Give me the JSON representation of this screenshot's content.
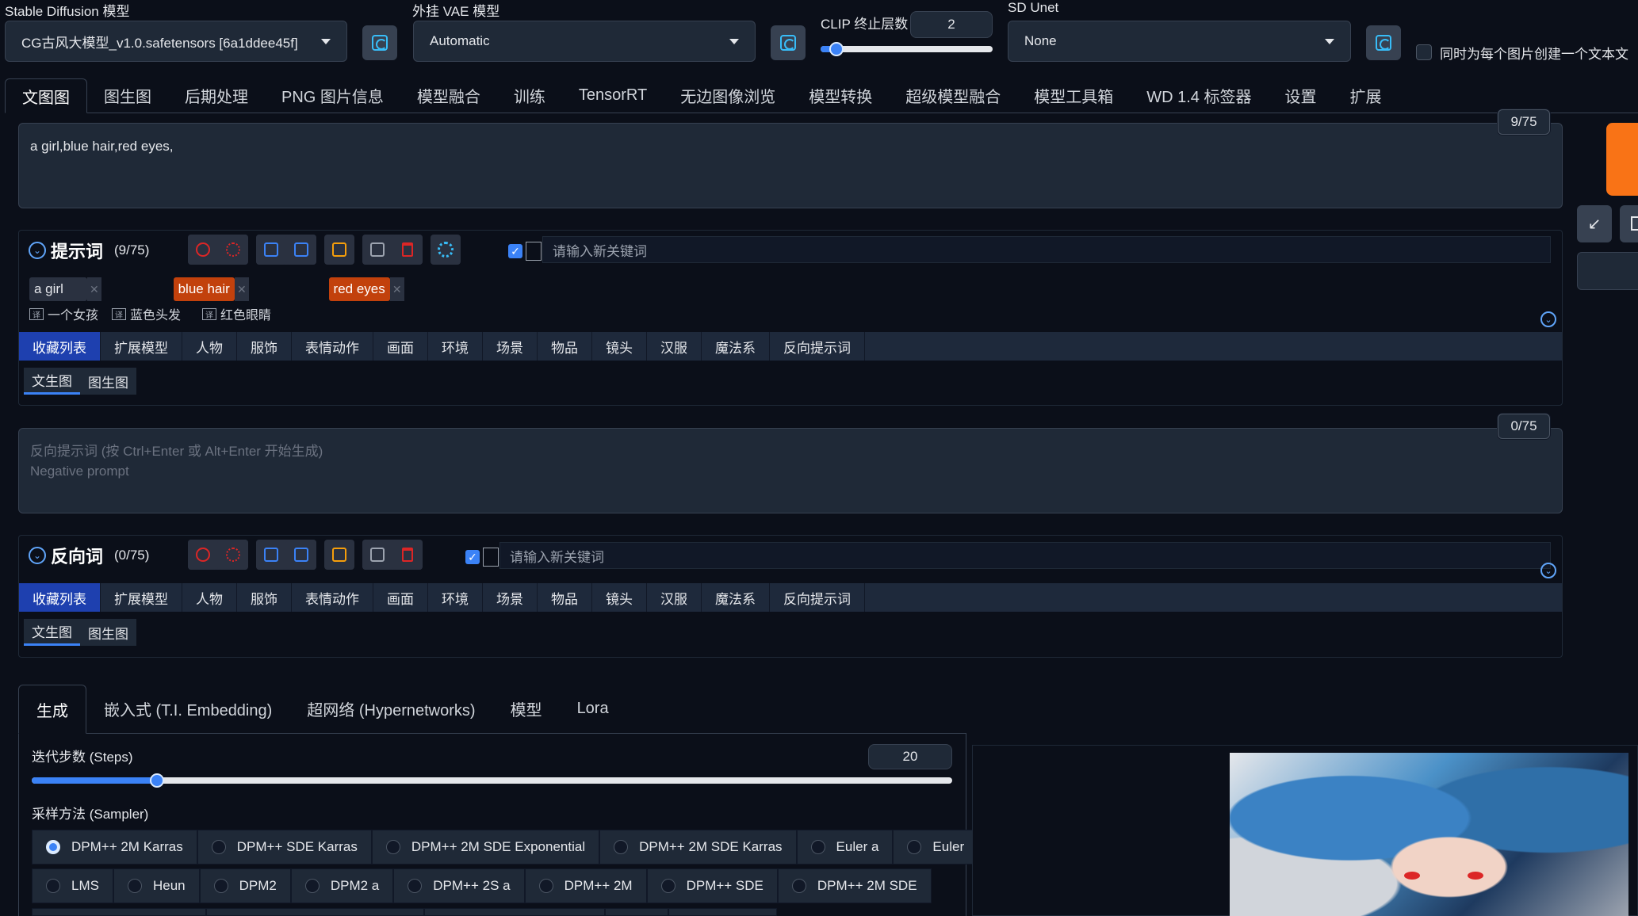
{
  "top": {
    "sd_model_label": "Stable Diffusion 模型",
    "sd_model_value": "CG古风大模型_v1.0.safetensors [6a1ddee45f]",
    "vae_label": "外挂 VAE 模型",
    "vae_value": "Automatic",
    "clip_label": "CLIP 终止层数",
    "clip_value": "2",
    "unet_label": "SD Unet",
    "unet_value": "None",
    "caption_checkbox_label": "同时为每个图片创建一个文本文"
  },
  "main_tabs": [
    "文图图",
    "图生图",
    "后期处理",
    "PNG 图片信息",
    "模型融合",
    "训练",
    "TensorRT",
    "无边图像浏览",
    "模型转换",
    "超级模型融合",
    "模型工具箱",
    "WD 1.4 标签器",
    "设置",
    "扩展"
  ],
  "prompt": {
    "text": "a girl,blue hair,red eyes,",
    "counter": "9/75"
  },
  "prompt_helper": {
    "title": "提示词",
    "count": "(9/75)",
    "keyword_placeholder": "请输入新关键词",
    "tags": [
      {
        "en": "a girl",
        "zh": "一个女孩"
      },
      {
        "en": "blue hair",
        "zh": "蓝色头发"
      },
      {
        "en": "red eyes",
        "zh": "红色眼睛"
      }
    ],
    "categories": [
      "收藏列表",
      "扩展模型",
      "人物",
      "服饰",
      "表情动作",
      "画面",
      "环境",
      "场景",
      "物品",
      "镜头",
      "汉服",
      "魔法系",
      "反向提示词"
    ],
    "subtabs": [
      "文生图",
      "图生图"
    ]
  },
  "negative": {
    "placeholder_line1": "反向提示词 (按 Ctrl+Enter 或 Alt+Enter 开始生成)",
    "placeholder_line2": "Negative prompt",
    "counter": "0/75"
  },
  "negative_helper": {
    "title": "反向词",
    "count": "(0/75)",
    "keyword_placeholder": "请输入新关键词",
    "categories": [
      "收藏列表",
      "扩展模型",
      "人物",
      "服饰",
      "表情动作",
      "画面",
      "环境",
      "场景",
      "物品",
      "镜头",
      "汉服",
      "魔法系",
      "反向提示词"
    ],
    "subtabs": [
      "文生图",
      "图生图"
    ]
  },
  "gen_tabs": [
    "生成",
    "嵌入式 (T.I. Embedding)",
    "超网络 (Hypernetworks)",
    "模型",
    "Lora"
  ],
  "steps": {
    "label": "迭代步数 (Steps)",
    "value": "20",
    "fraction": 0.136
  },
  "clip_slider_fraction": 0.09,
  "sampler": {
    "label": "采样方法 (Sampler)",
    "row1": [
      "DPM++ 2M Karras",
      "DPM++ SDE Karras",
      "DPM++ 2M SDE Exponential",
      "DPM++ 2M SDE Karras",
      "Euler a",
      "Euler"
    ],
    "row2": [
      "LMS",
      "Heun",
      "DPM2",
      "DPM2 a",
      "DPM++ 2S a",
      "DPM++ 2M",
      "DPM++ SDE",
      "DPM++ 2M SDE"
    ],
    "selected": "DPM++ 2M Karras"
  },
  "colors": {
    "accent": "#3b82f6",
    "generate": "#f97316",
    "background": "#0b0f19"
  }
}
